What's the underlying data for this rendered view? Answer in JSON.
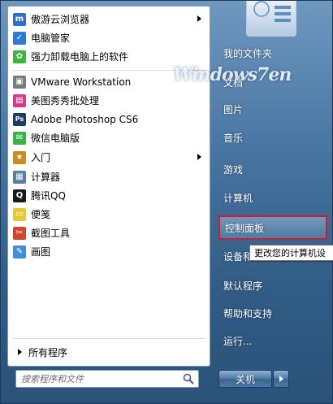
{
  "pinned": [
    {
      "label": "傲游云浏览器",
      "icon": "maxthon-icon",
      "color": "#2f6fcf",
      "glyph": "m",
      "submenu": true
    },
    {
      "label": "电脑管家",
      "icon": "shield-icon",
      "color": "#2b7ad8",
      "glyph": "✓",
      "submenu": false
    },
    {
      "label": "强力卸载电脑上的软件",
      "icon": "flower-icon",
      "color": "#3fb33f",
      "glyph": "✿",
      "submenu": false
    }
  ],
  "recent": [
    {
      "label": "VMware Workstation",
      "icon": "vmware-icon",
      "color": "#7a7a7a",
      "glyph": "▣",
      "submenu": false
    },
    {
      "label": "美图秀秀批处理",
      "icon": "image-batch-icon",
      "color": "#d63a8c",
      "glyph": "▤",
      "submenu": false
    },
    {
      "label": "Adobe Photoshop CS6",
      "icon": "photoshop-icon",
      "color": "#1b3c66",
      "glyph": "Ps",
      "submenu": false
    },
    {
      "label": "微信电脑版",
      "icon": "wechat-icon",
      "color": "#37b34a",
      "glyph": "✉",
      "submenu": false
    },
    {
      "label": "入门",
      "icon": "getting-started-icon",
      "color": "#c98a1e",
      "glyph": "★",
      "submenu": true
    },
    {
      "label": "计算器",
      "icon": "calculator-icon",
      "color": "#5a7ea8",
      "glyph": "▦",
      "submenu": false
    },
    {
      "label": "腾讯QQ",
      "icon": "qq-penguin-icon",
      "color": "#1a1a1a",
      "glyph": "Q",
      "submenu": false
    },
    {
      "label": "便笺",
      "icon": "sticky-notes-icon",
      "color": "#e7c83a",
      "glyph": "▭",
      "submenu": false
    },
    {
      "label": "截图工具",
      "icon": "snipping-tool-icon",
      "color": "#d2452c",
      "glyph": "✂",
      "submenu": false
    },
    {
      "label": "画图",
      "icon": "paint-icon",
      "color": "#3f8fd6",
      "glyph": "✎",
      "submenu": false
    }
  ],
  "all_programs_label": "所有程序",
  "search": {
    "placeholder": "搜索程序和文件"
  },
  "right_pane": [
    {
      "label": "我的文件夹"
    },
    {
      "label": "文档"
    },
    {
      "label": "图片"
    },
    {
      "label": "音乐"
    },
    {
      "label": "游戏"
    },
    {
      "label": "计算机"
    },
    {
      "label": "控制面板"
    },
    {
      "label": "设备和"
    },
    {
      "label": "默认程序"
    },
    {
      "label": "帮助和支持"
    },
    {
      "label": "运行..."
    }
  ],
  "tooltip": "更改您的计算机设",
  "watermark": "Windows7en",
  "shutdown_label": "关机",
  "colors": {
    "highlight_border": "#d8192c",
    "pane_bg": "#ffffff"
  }
}
